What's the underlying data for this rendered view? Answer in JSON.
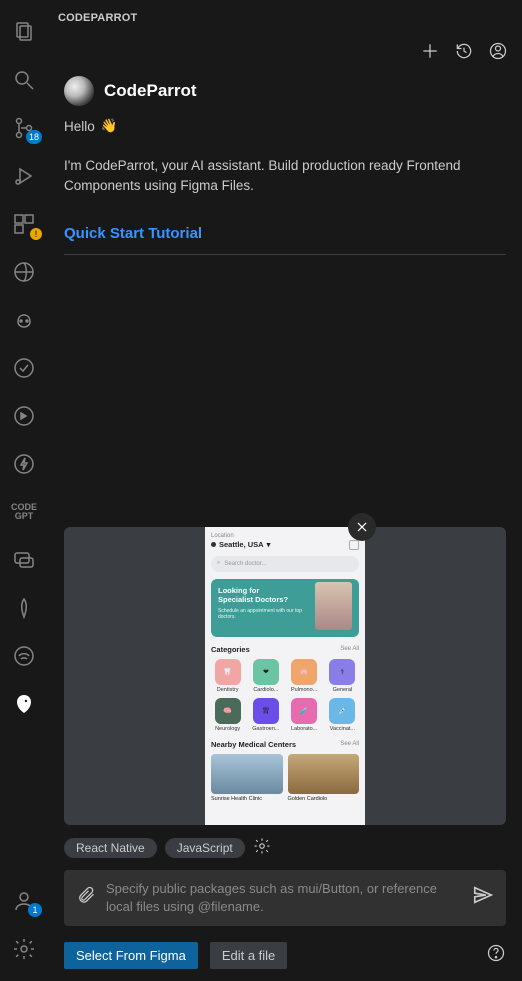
{
  "tab": {
    "title": "CODEPARROT"
  },
  "brand": {
    "name": "CodeParrot"
  },
  "hello": {
    "text": "Hello",
    "emoji": "👋"
  },
  "intro": "I'm CodeParrot, your AI assistant. Build production ready Frontend Components using Figma Files.",
  "quickstart": {
    "label": "Quick Start Tutorial"
  },
  "chips": {
    "react": "React Native",
    "js": "JavaScript"
  },
  "input": {
    "placeholder": "Specify public packages such as mui/Button, or reference local files using @filename."
  },
  "buttons": {
    "select_figma": "Select From Figma",
    "edit_file": "Edit a file"
  },
  "activity": {
    "scm_badge": "18",
    "accounts_badge": "1",
    "codegpt": "CODE\nGPT"
  },
  "mock": {
    "loc_label": "Location",
    "loc_value": "Seattle, USA",
    "search_placeholder": "Search doctor...",
    "banner_line1": "Looking for",
    "banner_line2": "Specialist Doctors?",
    "banner_sub": "Schedule an appointment with our top doctors.",
    "categories_title": "Categories",
    "see_all": "See All",
    "cats": [
      "Dentistry",
      "Cardiolo...",
      "Pulmono...",
      "General",
      "Neurology",
      "Gastroen...",
      "Laborato...",
      "Vaccinat..."
    ],
    "nearby_title": "Nearby Medical Centers",
    "med1": "Sunrise Health Clinic",
    "med2": "Golden Cardiolo"
  }
}
